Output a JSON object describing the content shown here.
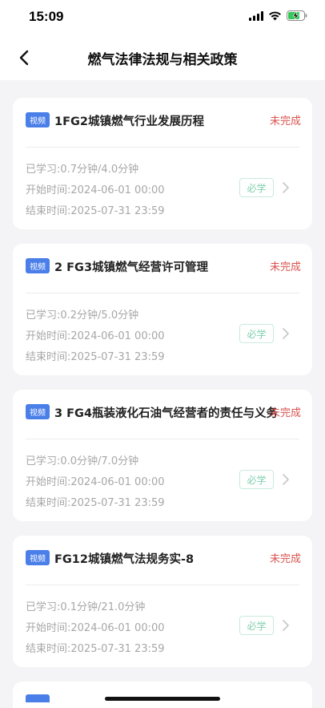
{
  "status_bar": {
    "time": "15:09"
  },
  "nav": {
    "title": "燃气法律法规与相关政策"
  },
  "courses": [
    {
      "badge": "视频",
      "title": "1FG2城镇燃气行业发展历程",
      "status": "未完成",
      "studied": "已学习:0.7分钟/4.0分钟",
      "start": "开始时间:2024-06-01 00:00",
      "end": "结束时间:2025-07-31 23:59",
      "required": "必学"
    },
    {
      "badge": "视频",
      "title": "2 FG3城镇燃气经营许可管理",
      "status": "未完成",
      "studied": "已学习:0.2分钟/5.0分钟",
      "start": "开始时间:2024-06-01 00:00",
      "end": "结束时间:2025-07-31 23:59",
      "required": "必学"
    },
    {
      "badge": "视频",
      "title": "3 FG4瓶装液化石油气经营者的责任与义务",
      "status": "未完成",
      "studied": "已学习:0.0分钟/7.0分钟",
      "start": "开始时间:2024-06-01 00:00",
      "end": "结束时间:2025-07-31 23:59",
      "required": "必学"
    },
    {
      "badge": "视频",
      "title": "FG12城镇燃气法规务实-8",
      "status": "未完成",
      "studied": "已学习:0.1分钟/21.0分钟",
      "start": "开始时间:2024-06-01 00:00",
      "end": "结束时间:2025-07-31 23:59",
      "required": "必学"
    }
  ],
  "colors": {
    "accent": "#4a7ee8",
    "status_incomplete": "#d9534f",
    "required": "#7fcfae"
  }
}
